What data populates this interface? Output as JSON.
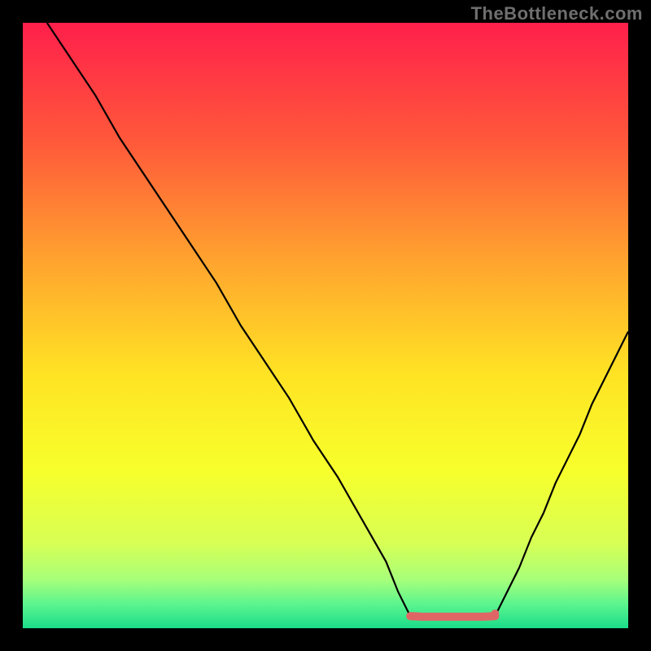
{
  "watermark": "TheBottleneck.com",
  "chart_data": {
    "type": "line",
    "title": "",
    "xlabel": "",
    "ylabel": "",
    "xlim": [
      0,
      100
    ],
    "ylim": [
      0,
      100
    ],
    "grid": false,
    "legend": false,
    "gradient_stops": [
      {
        "offset": 0.0,
        "color": "#ff1f4b"
      },
      {
        "offset": 0.2,
        "color": "#ff5a3a"
      },
      {
        "offset": 0.4,
        "color": "#ffa62e"
      },
      {
        "offset": 0.58,
        "color": "#ffe324"
      },
      {
        "offset": 0.74,
        "color": "#f7ff2b"
      },
      {
        "offset": 0.86,
        "color": "#d7ff55"
      },
      {
        "offset": 0.92,
        "color": "#a7ff7a"
      },
      {
        "offset": 0.96,
        "color": "#5cf58e"
      },
      {
        "offset": 1.0,
        "color": "#1bdd8a"
      }
    ],
    "series": [
      {
        "name": "left-limb",
        "stroke": "#000000",
        "stroke_width": 2.2,
        "x": [
          4,
          8,
          12,
          16,
          20,
          24,
          28,
          32,
          36,
          40,
          44,
          48,
          52,
          56,
          60,
          62,
          64
        ],
        "y": [
          100,
          94,
          88,
          81,
          75,
          69,
          63,
          57,
          50,
          44,
          38,
          31,
          25,
          18,
          11,
          6,
          2
        ]
      },
      {
        "name": "right-limb",
        "stroke": "#000000",
        "stroke_width": 2.2,
        "x": [
          78,
          80,
          82,
          84,
          86,
          88,
          90,
          92,
          94,
          96,
          98,
          100
        ],
        "y": [
          2,
          6,
          10,
          15,
          19,
          24,
          28,
          32,
          37,
          41,
          45,
          49
        ]
      },
      {
        "name": "trough-marker",
        "stroke": "#e06666",
        "stroke_width": 10,
        "linecap": "round",
        "x": [
          64,
          66,
          68,
          70,
          72,
          74,
          76,
          78
        ],
        "y": [
          2.0,
          1.9,
          1.9,
          1.9,
          1.9,
          1.9,
          1.9,
          2.0
        ]
      }
    ],
    "dot": {
      "x": 78,
      "y": 2.4,
      "r": 5,
      "fill": "#e06666"
    }
  }
}
